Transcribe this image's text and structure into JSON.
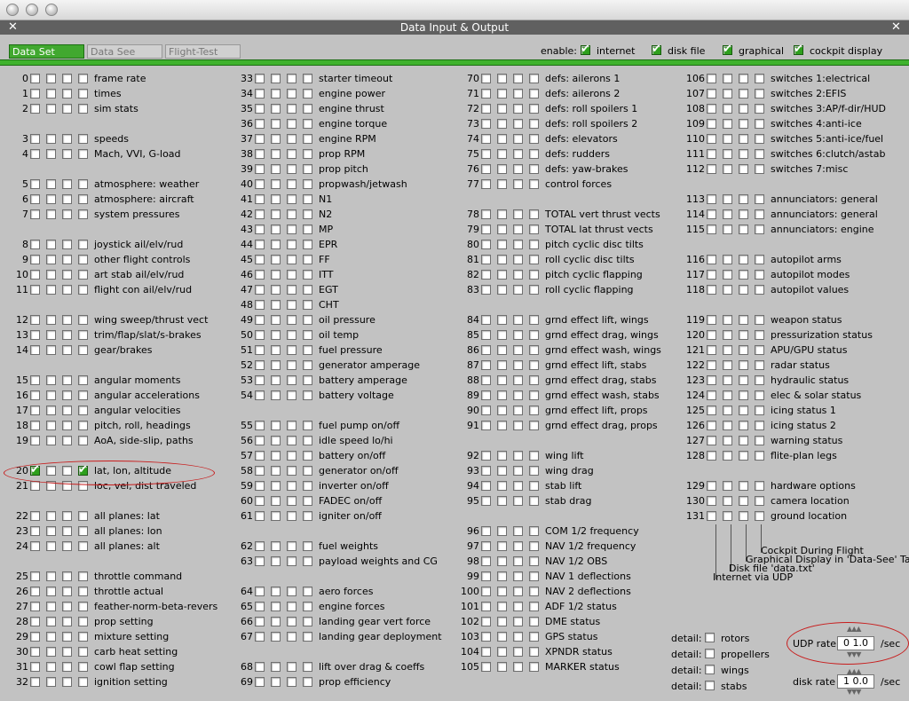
{
  "window": {
    "title": "Data Input & Output"
  },
  "tabs": [
    {
      "label": "Data Set",
      "active": true
    },
    {
      "label": "Data See",
      "active": false
    },
    {
      "label": "Flight-Test",
      "active": false
    }
  ],
  "enable": {
    "label": "enable:",
    "options": [
      {
        "label": "internet",
        "checked": true
      },
      {
        "label": "disk file",
        "checked": true
      },
      {
        "label": "graphical",
        "checked": true
      },
      {
        "label": "cockpit display",
        "checked": true
      }
    ]
  },
  "columns": [
    [
      {
        "n": "0",
        "label": "frame rate"
      },
      {
        "n": "1",
        "label": "times"
      },
      {
        "n": "2",
        "label": "sim stats"
      },
      null,
      {
        "n": "3",
        "label": "speeds"
      },
      {
        "n": "4",
        "label": "Mach, VVI, G-load"
      },
      null,
      {
        "n": "5",
        "label": "atmosphere: weather"
      },
      {
        "n": "6",
        "label": "atmosphere: aircraft"
      },
      {
        "n": "7",
        "label": "system pressures"
      },
      null,
      {
        "n": "8",
        "label": "joystick ail/elv/rud"
      },
      {
        "n": "9",
        "label": "other flight controls"
      },
      {
        "n": "10",
        "label": "art stab   ail/elv/rud"
      },
      {
        "n": "11",
        "label": "flight con ail/elv/rud"
      },
      null,
      {
        "n": "12",
        "label": "wing sweep/thrust vect"
      },
      {
        "n": "13",
        "label": "trim/flap/slat/s-brakes"
      },
      {
        "n": "14",
        "label": "gear/brakes"
      },
      null,
      {
        "n": "15",
        "label": "angular moments"
      },
      {
        "n": "16",
        "label": "angular accelerations"
      },
      {
        "n": "17",
        "label": "angular velocities"
      },
      {
        "n": "18",
        "label": "pitch, roll, headings"
      },
      {
        "n": "19",
        "label": "AoA, side-slip, paths"
      },
      null,
      {
        "n": "20",
        "label": "lat, lon, altitude",
        "checks": [
          true,
          false,
          false,
          true
        ]
      },
      {
        "n": "21",
        "label": "loc, vel, dist traveled"
      },
      null,
      {
        "n": "22",
        "label": "all planes: lat"
      },
      {
        "n": "23",
        "label": "all planes: lon"
      },
      {
        "n": "24",
        "label": "all planes: alt"
      },
      null,
      {
        "n": "25",
        "label": "throttle command"
      },
      {
        "n": "26",
        "label": "throttle actual"
      },
      {
        "n": "27",
        "label": "feather-norm-beta-revers"
      },
      {
        "n": "28",
        "label": "prop setting"
      },
      {
        "n": "29",
        "label": "mixture setting"
      },
      {
        "n": "30",
        "label": "carb heat setting"
      },
      {
        "n": "31",
        "label": "cowl flap setting"
      },
      {
        "n": "32",
        "label": "ignition setting"
      }
    ],
    [
      {
        "n": "33",
        "label": "starter timeout"
      },
      {
        "n": "34",
        "label": "engine power"
      },
      {
        "n": "35",
        "label": "engine thrust"
      },
      {
        "n": "36",
        "label": "engine torque"
      },
      {
        "n": "37",
        "label": "engine RPM"
      },
      {
        "n": "38",
        "label": "prop RPM"
      },
      {
        "n": "39",
        "label": "prop pitch"
      },
      {
        "n": "40",
        "label": "propwash/jetwash"
      },
      {
        "n": "41",
        "label": "N1"
      },
      {
        "n": "42",
        "label": "N2"
      },
      {
        "n": "43",
        "label": "MP"
      },
      {
        "n": "44",
        "label": "EPR"
      },
      {
        "n": "45",
        "label": "FF"
      },
      {
        "n": "46",
        "label": "ITT"
      },
      {
        "n": "47",
        "label": "EGT"
      },
      {
        "n": "48",
        "label": "CHT"
      },
      {
        "n": "49",
        "label": "oil pressure"
      },
      {
        "n": "50",
        "label": "oil temp"
      },
      {
        "n": "51",
        "label": "fuel pressure"
      },
      {
        "n": "52",
        "label": "generator amperage"
      },
      {
        "n": "53",
        "label": "battery amperage"
      },
      {
        "n": "54",
        "label": "battery voltage"
      },
      null,
      {
        "n": "55",
        "label": "fuel pump on/off"
      },
      {
        "n": "56",
        "label": "idle speed lo/hi"
      },
      {
        "n": "57",
        "label": "battery on/off"
      },
      {
        "n": "58",
        "label": "generator on/off"
      },
      {
        "n": "59",
        "label": "inverter on/off"
      },
      {
        "n": "60",
        "label": "FADEC on/off"
      },
      {
        "n": "61",
        "label": "igniter on/off"
      },
      null,
      {
        "n": "62",
        "label": "fuel weights"
      },
      {
        "n": "63",
        "label": "payload weights and CG"
      },
      null,
      {
        "n": "64",
        "label": "aero forces"
      },
      {
        "n": "65",
        "label": "engine forces"
      },
      {
        "n": "66",
        "label": "landing gear vert force"
      },
      {
        "n": "67",
        "label": "landing gear deployment"
      },
      null,
      {
        "n": "68",
        "label": "lift over drag & coeffs"
      },
      {
        "n": "69",
        "label": "prop efficiency"
      }
    ],
    [
      {
        "n": "70",
        "label": "defs: ailerons 1"
      },
      {
        "n": "71",
        "label": "defs: ailerons 2"
      },
      {
        "n": "72",
        "label": "defs: roll spoilers 1"
      },
      {
        "n": "73",
        "label": "defs: roll spoilers 2"
      },
      {
        "n": "74",
        "label": "defs: elevators"
      },
      {
        "n": "75",
        "label": "defs: rudders"
      },
      {
        "n": "76",
        "label": "defs: yaw-brakes"
      },
      {
        "n": "77",
        "label": "control forces"
      },
      null,
      {
        "n": "78",
        "label": "TOTAL vert thrust vects"
      },
      {
        "n": "79",
        "label": "TOTAL lat  thrust vects"
      },
      {
        "n": "80",
        "label": "pitch cyclic disc tilts"
      },
      {
        "n": "81",
        "label": "roll cyclic disc tilts"
      },
      {
        "n": "82",
        "label": "pitch cyclic flapping"
      },
      {
        "n": "83",
        "label": "roll cyclic flapping"
      },
      null,
      {
        "n": "84",
        "label": "grnd effect lift, wings"
      },
      {
        "n": "85",
        "label": "grnd effect drag, wings"
      },
      {
        "n": "86",
        "label": "grnd effect wash, wings"
      },
      {
        "n": "87",
        "label": "grnd effect lift, stabs"
      },
      {
        "n": "88",
        "label": "grnd effect drag, stabs"
      },
      {
        "n": "89",
        "label": "grnd effect wash, stabs"
      },
      {
        "n": "90",
        "label": "grnd effect lift, props"
      },
      {
        "n": "91",
        "label": "grnd effect drag, props"
      },
      null,
      {
        "n": "92",
        "label": "wing lift"
      },
      {
        "n": "93",
        "label": "wing drag"
      },
      {
        "n": "94",
        "label": "stab lift"
      },
      {
        "n": "95",
        "label": "stab drag"
      },
      null,
      {
        "n": "96",
        "label": "COM 1/2 frequency"
      },
      {
        "n": "97",
        "label": "NAV 1/2 frequency"
      },
      {
        "n": "98",
        "label": "NAV 1/2 OBS"
      },
      {
        "n": "99",
        "label": "NAV 1 deflections"
      },
      {
        "n": "100",
        "label": "NAV 2 deflections"
      },
      {
        "n": "101",
        "label": "ADF 1/2 status"
      },
      {
        "n": "102",
        "label": "DME status"
      },
      {
        "n": "103",
        "label": "GPS status"
      },
      {
        "n": "104",
        "label": "XPNDR status"
      },
      {
        "n": "105",
        "label": "MARKER status"
      }
    ],
    [
      {
        "n": "106",
        "label": "switches 1:electrical"
      },
      {
        "n": "107",
        "label": "switches 2:EFIS"
      },
      {
        "n": "108",
        "label": "switches 3:AP/f-dir/HUD"
      },
      {
        "n": "109",
        "label": "switches 4:anti-ice"
      },
      {
        "n": "110",
        "label": "switches 5:anti-ice/fuel"
      },
      {
        "n": "111",
        "label": "switches 6:clutch/astab"
      },
      {
        "n": "112",
        "label": "switches 7:misc"
      },
      null,
      {
        "n": "113",
        "label": "annunciators: general"
      },
      {
        "n": "114",
        "label": "annunciators: general"
      },
      {
        "n": "115",
        "label": "annunciators: engine"
      },
      null,
      {
        "n": "116",
        "label": "autopilot arms"
      },
      {
        "n": "117",
        "label": "autopilot modes"
      },
      {
        "n": "118",
        "label": "autopilot values"
      },
      null,
      {
        "n": "119",
        "label": "weapon status"
      },
      {
        "n": "120",
        "label": "pressurization status"
      },
      {
        "n": "121",
        "label": "APU/GPU status"
      },
      {
        "n": "122",
        "label": "radar status"
      },
      {
        "n": "123",
        "label": "hydraulic status"
      },
      {
        "n": "124",
        "label": "elec & solar status"
      },
      {
        "n": "125",
        "label": "icing status 1"
      },
      {
        "n": "126",
        "label": "icing status 2"
      },
      {
        "n": "127",
        "label": "warning status"
      },
      {
        "n": "128",
        "label": "flite-plan legs"
      },
      null,
      {
        "n": "129",
        "label": "hardware options"
      },
      {
        "n": "130",
        "label": "camera location"
      },
      {
        "n": "131",
        "label": "ground location"
      }
    ]
  ],
  "legend": {
    "cockpit": "Cockpit During Flight",
    "graphical": "Graphical Display in 'Data-See' Tab",
    "disk": "Disk file 'data.txt'",
    "internet": "Internet via UDP"
  },
  "details": {
    "label": "detail:",
    "items": [
      {
        "label": "rotors",
        "checked": false
      },
      {
        "label": "propellers",
        "checked": false
      },
      {
        "label": "wings",
        "checked": false
      },
      {
        "label": "stabs",
        "checked": false
      }
    ]
  },
  "rates": {
    "udp_label": "UDP rate",
    "udp_value": "0 1.0",
    "disk_label": "disk rate",
    "disk_value": "1 0.0",
    "unit": "/sec"
  }
}
